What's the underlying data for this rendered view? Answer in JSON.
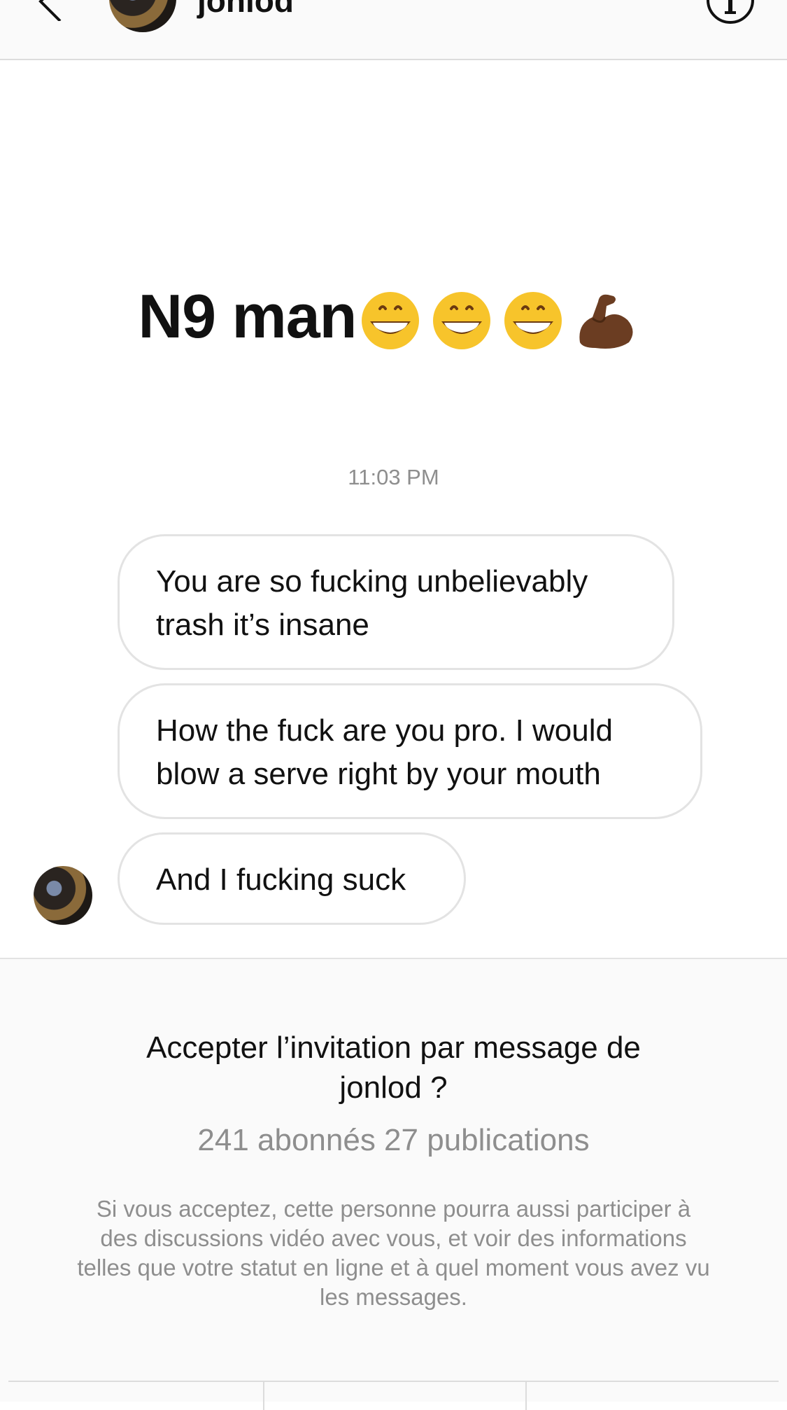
{
  "header": {
    "username": "jonlod",
    "back_icon": "chevron-left-icon",
    "info_icon": "info-icon"
  },
  "thread": {
    "big_message": {
      "text": "N9 man",
      "emojis": [
        "grinning-face-with-smiling-eyes",
        "grinning-face-with-smiling-eyes",
        "grinning-face-with-smiling-eyes",
        "flexed-biceps-dark-skin-tone"
      ]
    },
    "timestamp": "11:03 PM",
    "messages": [
      {
        "text": "You are so fucking unbelievably trash it’s insane"
      },
      {
        "text": "How the fuck are you pro. I would blow a serve right by your mouth"
      },
      {
        "text": "And I fucking suck"
      }
    ]
  },
  "invitation": {
    "title": "Accepter l’invitation par message de jonlod ?",
    "stats": "241 abonnés 27 publications",
    "description": "Si vous acceptez, cette personne pourra aussi participer à des discussions vidéo avec vous, et voir des informations telles que votre statut en ligne et à quel moment vous avez vu les messages."
  },
  "colors": {
    "header_bg": "#fafafa",
    "bubble_border": "#e3e3e3",
    "secondary_text": "#8e8e8e",
    "emoji_yellow": "#f7c42b",
    "biceps": "#6b3d22"
  }
}
